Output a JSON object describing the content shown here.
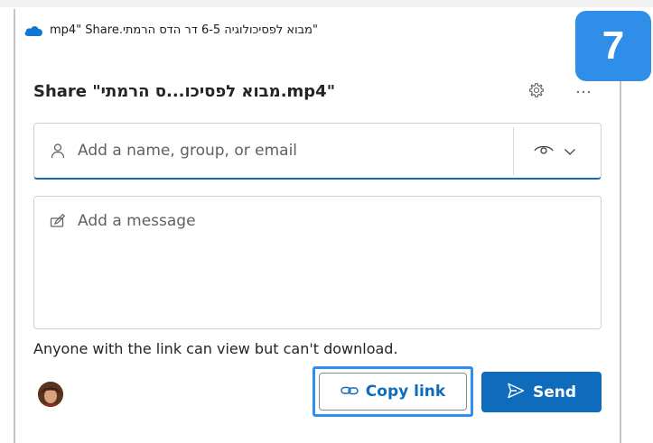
{
  "window": {
    "title": "\"מבוא לפסיכולוגיה 6-5 דר הדס הרמתי.mp4\" Share"
  },
  "step_badge": "7",
  "dialog": {
    "title": "Share \"מבוא לפסיכו...ס הרמתי.mp4\"",
    "recipient": {
      "placeholder": "Add a name, group, or email",
      "value": ""
    },
    "message": {
      "placeholder": "Add a message",
      "value": ""
    },
    "link_permission_text": "Anyone with the link can view but can't download.",
    "copy_link_label": "Copy link",
    "send_label": "Send"
  },
  "icons": {
    "app": "onedrive-cloud-icon",
    "settings": "gear-icon",
    "more": "ellipsis-icon",
    "person": "person-icon",
    "permission": "eye-icon",
    "dropdown": "chevron-down-icon",
    "message": "pencil-icon",
    "copy": "link-icon",
    "send": "send-icon"
  },
  "colors": {
    "accent": "#0f6cbd",
    "badge": "#2f8fe8",
    "focus_outline": "#2b8ef0"
  }
}
